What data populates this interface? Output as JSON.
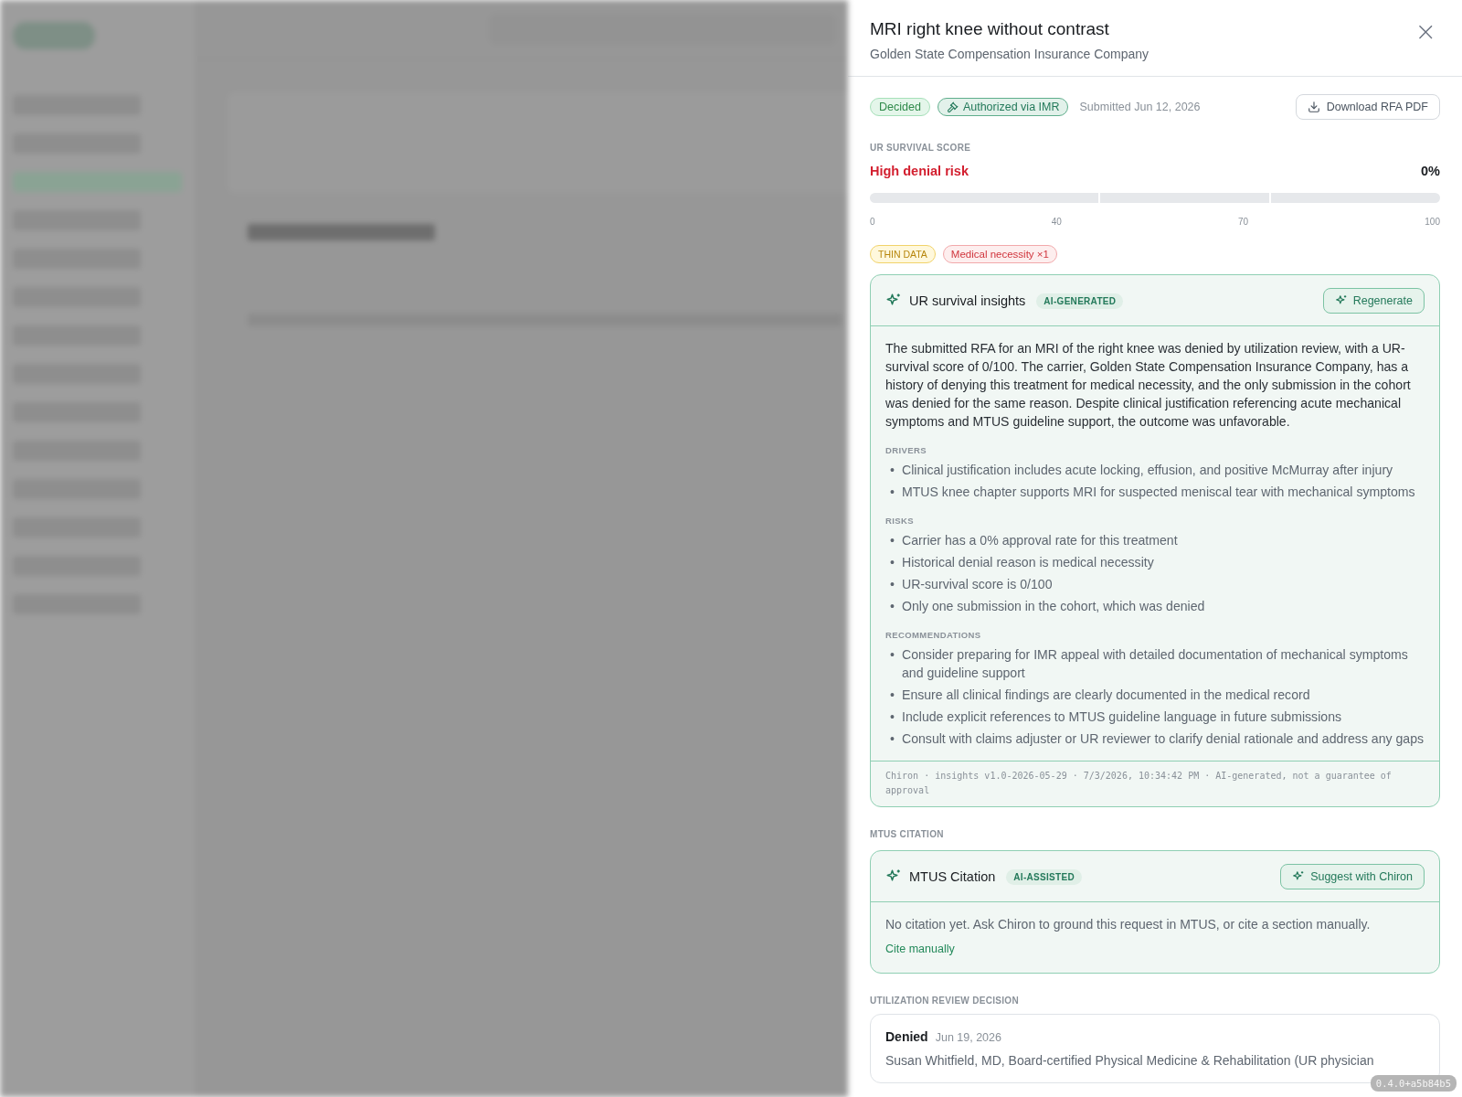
{
  "drawer": {
    "title": "MRI right knee without contrast",
    "subtitle": "Golden State Compensation Insurance Company",
    "close_label": "×",
    "status_pills": [
      {
        "label": "Decided",
        "kind": "success"
      },
      {
        "label": "Authorized via IMR",
        "kind": "imr"
      }
    ],
    "submitted": "Submitted Jun 12, 2026",
    "download_button": "Download RFA PDF",
    "score": {
      "section_label": "UR SURVIVAL SCORE",
      "risk_label": "High denial risk",
      "value": "0%",
      "ticks": [
        "0",
        "40",
        "70",
        "100"
      ]
    },
    "tags": [
      {
        "label": "THIN DATA",
        "kind": "warning"
      },
      {
        "label": "Medical necessity ×1",
        "kind": "danger"
      }
    ],
    "insights": {
      "title": "UR survival insights",
      "badge": "AI-GENERATED",
      "button": "Regenerate",
      "bullet": "•",
      "summary": "The submitted RFA for an MRI of the right knee was denied by utilization review, with a UR-survival score of 0/100. The carrier, Golden State Compensation Insurance Company, has a history of denying this treatment for medical necessity, and the only submission in the cohort was denied for the same reason. Despite clinical justification referencing acute mechanical symptoms and MTUS guideline support, the outcome was unfavorable.",
      "sections": [
        {
          "heading": "DRIVERS",
          "items": [
            "Clinical justification includes acute locking, effusion, and positive McMurray after injury",
            "MTUS knee chapter supports MRI for suspected meniscal tear with mechanical symptoms"
          ]
        },
        {
          "heading": "RISKS",
          "items": [
            "Carrier has a 0% approval rate for this treatment",
            "Historical denial reason is medical necessity",
            "UR-survival score is 0/100",
            "Only one submission in the cohort, which was denied"
          ]
        },
        {
          "heading": "RECOMMENDATIONS",
          "items": [
            "Consider preparing for IMR appeal with detailed documentation of mechanical symptoms and guideline support",
            "Ensure all clinical findings are clearly documented in the medical record",
            "Include explicit references to MTUS guideline language in future submissions",
            "Consult with claims adjuster or UR reviewer to clarify denial rationale and address any gaps"
          ]
        }
      ],
      "footer": "Chiron · insights v1.0-2026-05-29 · 7/3/2026, 10:34:42 PM · AI-generated, not a guarantee of approval"
    },
    "citation": {
      "section_label": "MTUS CITATION",
      "title": "MTUS Citation",
      "badge": "AI-ASSISTED",
      "button": "Suggest with Chiron",
      "text": "No citation yet. Ask Chiron to ground this request in MTUS, or cite a section manually.",
      "link": "Cite manually"
    },
    "decision": {
      "section_label": "UTILIZATION REVIEW DECISION",
      "outcome": "Denied",
      "date": "Jun 19, 2026",
      "reviewer": "Susan Whitfield, MD, Board-certified Physical Medicine & Rehabilitation (UR physician"
    }
  },
  "version_badge": "0.4.0+a5b84b5"
}
